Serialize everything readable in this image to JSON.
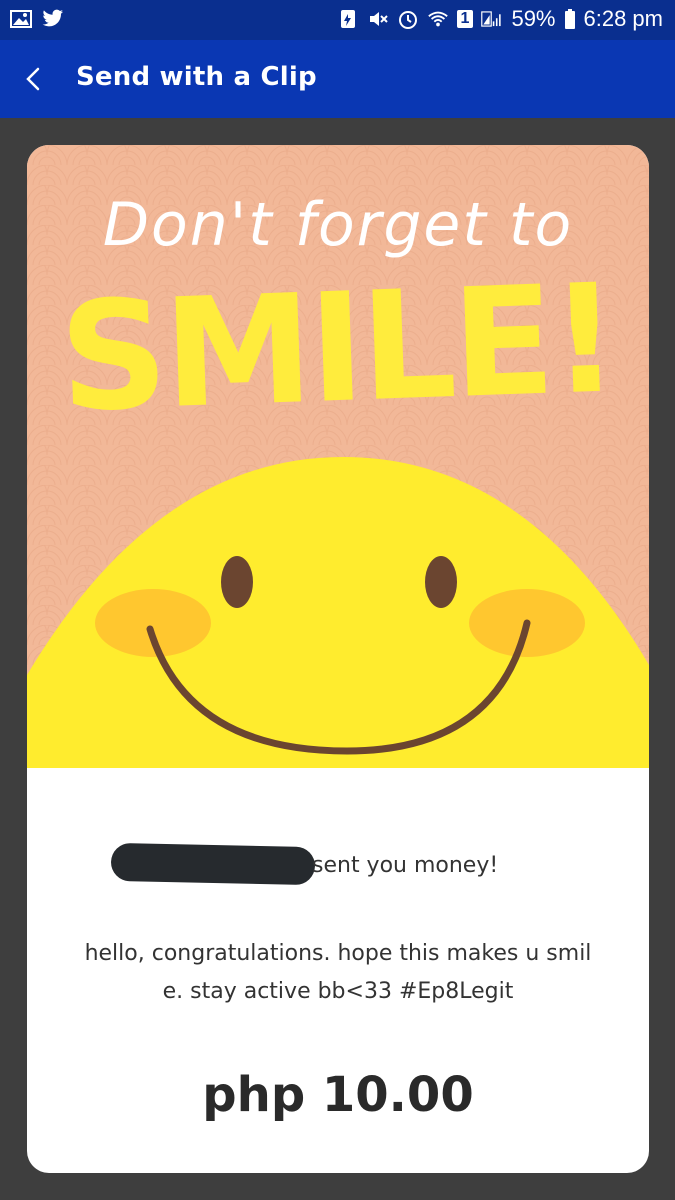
{
  "status_bar": {
    "battery": "59%",
    "time": "6:28 pm",
    "notification_badge": "1",
    "icons": [
      "image-icon",
      "twitter-icon",
      "battery-saver-icon",
      "mute-icon",
      "alarm-icon",
      "wifi-icon",
      "sim-icon",
      "signal-icon",
      "battery-icon"
    ]
  },
  "app_bar": {
    "title": "Send with a Clip",
    "back_icon": "chevron-left-icon",
    "background": "#0a37b3"
  },
  "card": {
    "art": {
      "line1": "Don't forget to",
      "line2": "SMILE!",
      "background": "#f2b898",
      "smiley_color": "#ffec2e",
      "cheek_color": "#ffc72f",
      "feature_color": "#6b4530",
      "text_color_line2": "#ffec3d"
    },
    "sender_suffix": "sent you money!",
    "message": "hello, congratulations. hope this makes u smil\ne. stay active bb<33 #Ep8Legit",
    "message_line1": "hello, congratulations. hope this makes u smil",
    "message_line2": "e. stay active bb<33 #Ep8Legit",
    "amount": "php 10.00"
  }
}
